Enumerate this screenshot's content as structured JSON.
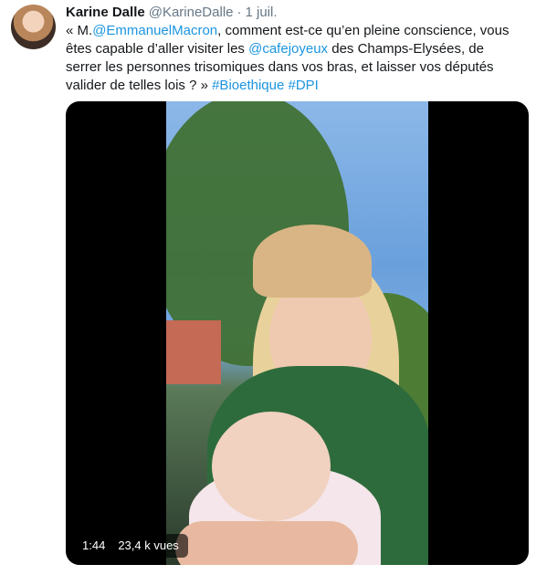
{
  "tweet": {
    "avatar_alt": "Karine Dalle",
    "name": "Karine Dalle",
    "handle": "@KarineDalle",
    "separator": "·",
    "date": "1 juil.",
    "text": {
      "open_quote": "« M.",
      "mention_macron": "@EmmanuelMacron",
      "part2": ", comment est-ce qu’en pleine conscience, vous êtes capable d’aller visiter les ",
      "mention_cafe": "@cafejoyeux",
      "part3": " des Champs-Elysées, de serrer les personnes trisomiques dans vos bras, et laisser vos députés valider de telles lois ? » ",
      "hashtag_bioethique": "#Bioethique",
      "space": " ",
      "hashtag_dpi": "#DPI"
    },
    "video": {
      "duration": "1:44",
      "views": "23,4 k vues"
    }
  }
}
